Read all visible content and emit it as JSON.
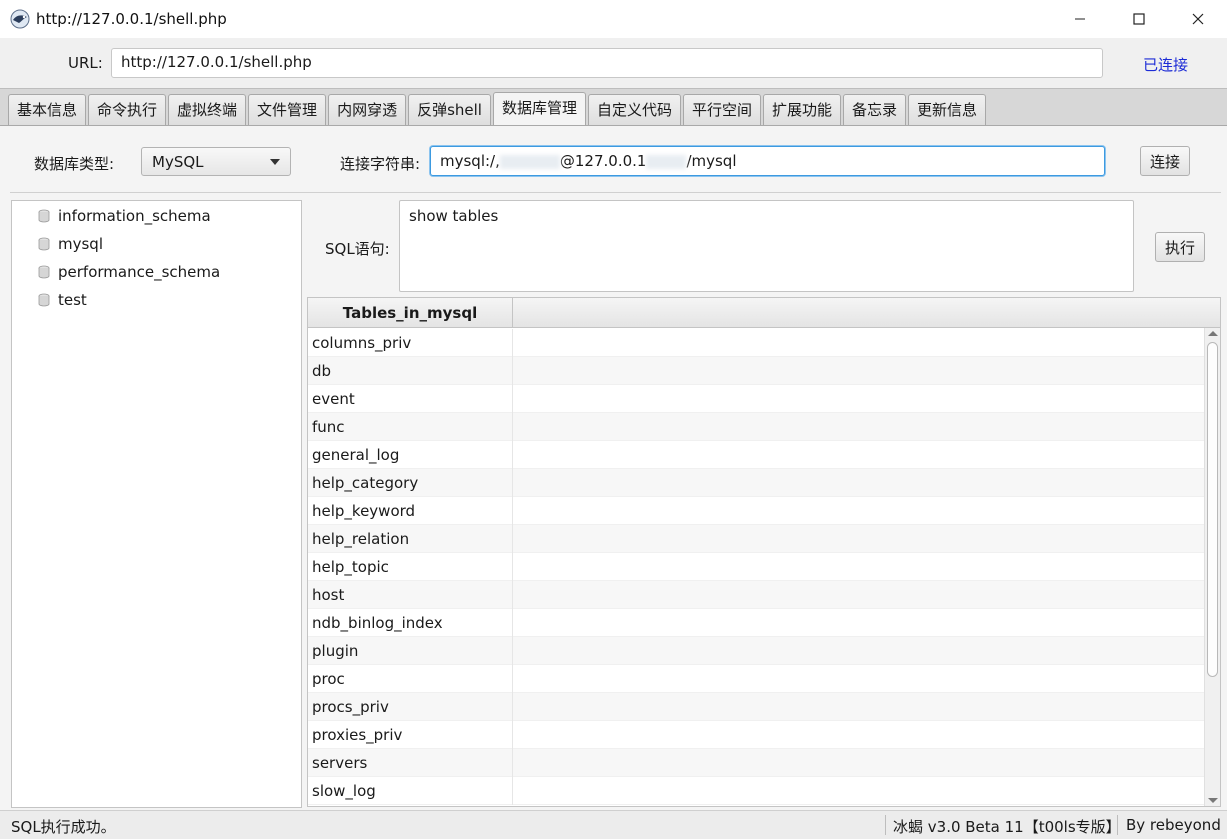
{
  "window": {
    "title": "http://127.0.0.1/shell.php"
  },
  "url_bar": {
    "label": "URL:",
    "value": "http://127.0.0.1/shell.php",
    "status": "已连接"
  },
  "tabs": [
    {
      "label": "基本信息"
    },
    {
      "label": "命令执行"
    },
    {
      "label": "虚拟终端"
    },
    {
      "label": "文件管理"
    },
    {
      "label": "内网穿透"
    },
    {
      "label": "反弹shell"
    },
    {
      "label": "数据库管理",
      "active": true
    },
    {
      "label": "自定义代码"
    },
    {
      "label": "平行空间"
    },
    {
      "label": "扩展功能"
    },
    {
      "label": "备忘录"
    },
    {
      "label": "更新信息"
    }
  ],
  "db_connection": {
    "type_label": "数据库类型:",
    "type_value": "MySQL",
    "connstr_label": "连接字符串:",
    "connstr_prefix": "mysql:/,",
    "connstr_mid": "@127.0.0.1",
    "connstr_suffix": "/mysql",
    "connect_button": "连接"
  },
  "databases": [
    {
      "name": "information_schema"
    },
    {
      "name": "mysql"
    },
    {
      "name": "performance_schema"
    },
    {
      "name": "test"
    }
  ],
  "sql": {
    "label": "SQL语句:",
    "value": "show tables",
    "execute_button": "执行"
  },
  "results": {
    "header": "Tables_in_mysql",
    "rows": [
      "columns_priv",
      "db",
      "event",
      "func",
      "general_log",
      "help_category",
      "help_keyword",
      "help_relation",
      "help_topic",
      "host",
      "ndb_binlog_index",
      "plugin",
      "proc",
      "procs_priv",
      "proxies_priv",
      "servers",
      "slow_log"
    ]
  },
  "status_bar": {
    "message": "SQL执行成功。",
    "version": "冰蝎 v3.0 Beta 11【t00ls专版】",
    "author": "By rebeyond"
  },
  "colors": {
    "status_link": "#1c2bd6",
    "focus_border": "#3d9ae0"
  }
}
